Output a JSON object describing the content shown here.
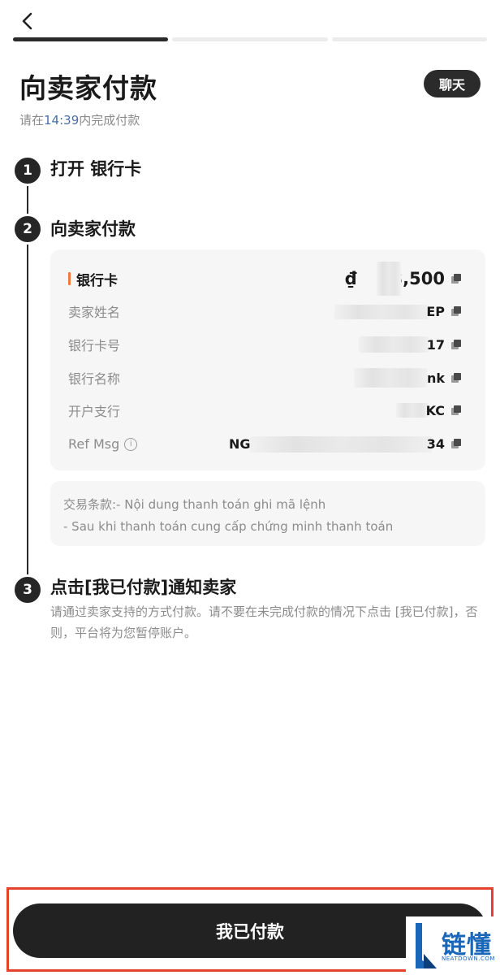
{
  "header": {
    "progress_steps": 3,
    "active_step": 1
  },
  "title": "向卖家付款",
  "chat_label": "聊天",
  "countdown": {
    "prefix": "请在",
    "time": "14:39",
    "suffix": "内完成付款"
  },
  "steps": [
    {
      "number": "1",
      "title": "打开 银行卡"
    },
    {
      "number": "2",
      "title": "向卖家付款"
    },
    {
      "number": "3",
      "title": "点击[我已付款]通知卖家"
    }
  ],
  "payment_details": {
    "method_label": "银行卡",
    "amount_prefix": "₫",
    "amount_suffix": "3,500",
    "rows": [
      {
        "label": "卖家姓名",
        "value_suffix": "EP"
      },
      {
        "label": "银行卡号",
        "value_suffix": "17"
      },
      {
        "label": "银行名称",
        "value_suffix": "nk"
      },
      {
        "label": "开户支行",
        "value_suffix": "KC"
      },
      {
        "label": "Ref Msg",
        "value_prefix": "NG",
        "value_suffix": "34"
      }
    ]
  },
  "terms": {
    "line1": "交易条款:- Nội dung thanh toán ghi mã lệnh",
    "line2": "- Sau khi thanh toán cung cấp chứng minh thanh toán"
  },
  "step3_description": "请通过卖家支持的方式付款。请不要在未完成付款的情况下点击 [我已付款]，否则，平台将为您暂停账户。",
  "pay_button_label": "我已付款",
  "watermark": {
    "text": "链懂",
    "subtext": "NEATDOWN.COM"
  },
  "colors": {
    "dark": "#222222",
    "accent": "#f07a3a",
    "time": "#4a6fa5",
    "highlight_frame": "#e5412c",
    "watermark": "#1a66b8"
  }
}
